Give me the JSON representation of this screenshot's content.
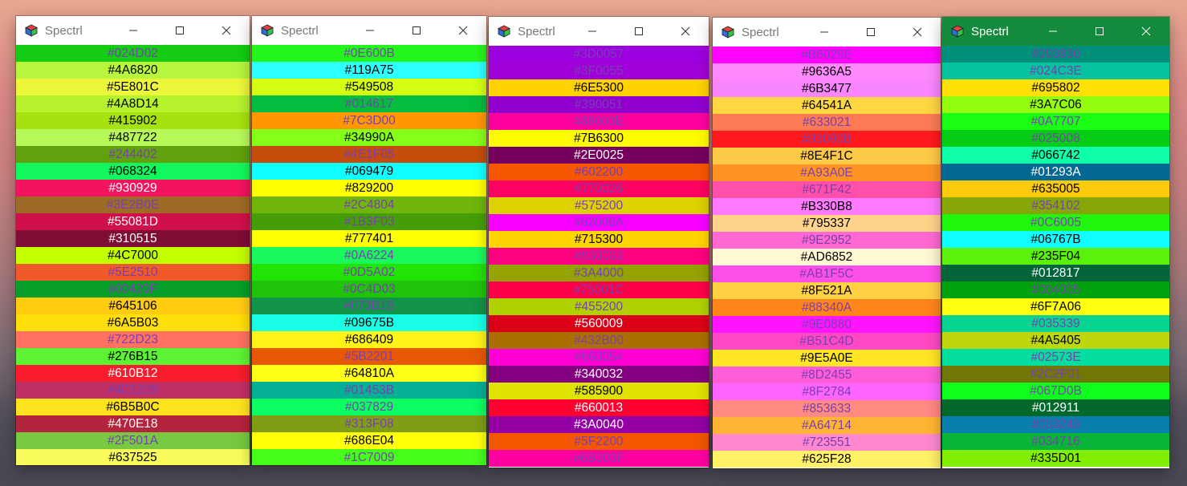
{
  "windows": [
    {
      "title": "Spectrl",
      "active": false,
      "rows": [
        {
          "label": "#024D02",
          "bg": "#13cc13",
          "fg": "#7a3fb0"
        },
        {
          "label": "#4A6820",
          "bg": "#b8f53f",
          "fg": "#000000"
        },
        {
          "label": "#5E801C",
          "bg": "#ecf73a",
          "fg": "#000000"
        },
        {
          "label": "#4A8D14",
          "bg": "#b7f22f",
          "fg": "#000000"
        },
        {
          "label": "#415902",
          "bg": "#a6e20f",
          "fg": "#000000"
        },
        {
          "label": "#487722",
          "bg": "#b8f95a",
          "fg": "#000000"
        },
        {
          "label": "#244402",
          "bg": "#61a10d",
          "fg": "#7a3fb0"
        },
        {
          "label": "#068324",
          "bg": "#12f75d",
          "fg": "#000000"
        },
        {
          "label": "#930929",
          "bg": "#f3135f",
          "fg": "#ffffff"
        },
        {
          "label": "#3E2B0E",
          "bg": "#9d6b25",
          "fg": "#7a3fb0"
        },
        {
          "label": "#55081D",
          "bg": "#d0104a",
          "fg": "#ffffff"
        },
        {
          "label": "#310515",
          "bg": "#7f0d36",
          "fg": "#ffffff"
        },
        {
          "label": "#4C7000",
          "bg": "#c3ff00",
          "fg": "#000000"
        },
        {
          "label": "#5E2510",
          "bg": "#f05a28",
          "fg": "#7a3fb0"
        },
        {
          "label": "#00420F",
          "bg": "#079e29",
          "fg": "#7a3fb0"
        },
        {
          "label": "#645106",
          "bg": "#ffcc10",
          "fg": "#000000"
        },
        {
          "label": "#6A5B03",
          "bg": "#ffdf07",
          "fg": "#000000"
        },
        {
          "label": "#722D23",
          "bg": "#ff7160",
          "fg": "#7a3fb0"
        },
        {
          "label": "#276B15",
          "bg": "#5ef235",
          "fg": "#000000"
        },
        {
          "label": "#610B12",
          "bg": "#f81c2c",
          "fg": "#ffffff"
        },
        {
          "label": "#4C1228",
          "bg": "#c02e66",
          "fg": "#7a3fb0"
        },
        {
          "label": "#6B5B0C",
          "bg": "#ffe21e",
          "fg": "#000000"
        },
        {
          "label": "#470E18",
          "bg": "#b5243d",
          "fg": "#ffffff"
        },
        {
          "label": "#2F501A",
          "bg": "#78c842",
          "fg": "#7a3fb0"
        },
        {
          "label": "#637525",
          "bg": "#f9fb5c",
          "fg": "#000000"
        }
      ]
    },
    {
      "title": "Spectrl",
      "active": false,
      "rows": [
        {
          "label": "#0E600B",
          "bg": "#24f61c",
          "fg": "#7a3fb0"
        },
        {
          "label": "#119A75",
          "bg": "#2effff",
          "fg": "#000000"
        },
        {
          "label": "#549508",
          "bg": "#d4ff13",
          "fg": "#000000"
        },
        {
          "label": "#014617",
          "bg": "#04bd3e",
          "fg": "#7a3fb0"
        },
        {
          "label": "#7C3D00",
          "bg": "#ff9800",
          "fg": "#7a3fb0"
        },
        {
          "label": "#34990A",
          "bg": "#86ff19",
          "fg": "#000000"
        },
        {
          "label": "#4E1F05",
          "bg": "#c44d0c",
          "fg": "#7a3fb0"
        },
        {
          "label": "#069479",
          "bg": "#10ffff",
          "fg": "#000000"
        },
        {
          "label": "#829200",
          "bg": "#ffff00",
          "fg": "#000000"
        },
        {
          "label": "#2C4804",
          "bg": "#70b50a",
          "fg": "#7a3fb0"
        },
        {
          "label": "#1B3F03",
          "bg": "#459e07",
          "fg": "#7a3fb0"
        },
        {
          "label": "#777401",
          "bg": "#ffff03",
          "fg": "#000000"
        },
        {
          "label": "#0A6224",
          "bg": "#19f95c",
          "fg": "#7a3fb0"
        },
        {
          "label": "#0D5A02",
          "bg": "#21e305",
          "fg": "#7a3fb0"
        },
        {
          "label": "#0C4D03",
          "bg": "#1fc408",
          "fg": "#7a3fb0"
        },
        {
          "label": "#073B1B",
          "bg": "#129449",
          "fg": "#7a3fb0"
        },
        {
          "label": "#09675B",
          "bg": "#18ffe6",
          "fg": "#000000"
        },
        {
          "label": "#686409",
          "bg": "#fff416",
          "fg": "#000000"
        },
        {
          "label": "#5B2201",
          "bg": "#e85804",
          "fg": "#7a3fb0"
        },
        {
          "label": "#64810A",
          "bg": "#fffe17",
          "fg": "#000000"
        },
        {
          "label": "#01453B",
          "bg": "#04b093",
          "fg": "#7a3fb0"
        },
        {
          "label": "#037829",
          "bg": "#0cfe62",
          "fg": "#7a3fb0"
        },
        {
          "label": "#313F08",
          "bg": "#7f9e16",
          "fg": "#7a3fb0"
        },
        {
          "label": "#686E04",
          "bg": "#ffff0a",
          "fg": "#000000"
        },
        {
          "label": "#1C7009",
          "bg": "#46fd1c",
          "fg": "#7a3fb0"
        }
      ]
    },
    {
      "title": "Spectrl",
      "active": false,
      "rows": [
        {
          "label": "#3D0057",
          "bg": "#9b00de",
          "fg": "#7a3fb0"
        },
        {
          "label": "#3F0055",
          "bg": "#a000d8",
          "fg": "#7a3fb0"
        },
        {
          "label": "#6E5300",
          "bg": "#ffd200",
          "fg": "#000000"
        },
        {
          "label": "#390051",
          "bg": "#9100cf",
          "fg": "#7a3fb0"
        },
        {
          "label": "#88003E",
          "bg": "#ff009e",
          "fg": "#7a3fb0"
        },
        {
          "label": "#7B6300",
          "bg": "#fffb00",
          "fg": "#000000"
        },
        {
          "label": "#2E0025",
          "bg": "#75005e",
          "fg": "#ffffff"
        },
        {
          "label": "#602200",
          "bg": "#f55600",
          "fg": "#7a3fb0"
        },
        {
          "label": "#770026",
          "bg": "#fe0061",
          "fg": "#7a3fb0"
        },
        {
          "label": "#575200",
          "bg": "#ddd100",
          "fg": "#7a3fb0"
        },
        {
          "label": "#62006A",
          "bg": "#f800ff",
          "fg": "#7a3fb0"
        },
        {
          "label": "#715300",
          "bg": "#ffd400",
          "fg": "#000000"
        },
        {
          "label": "#830033",
          "bg": "#ff0081",
          "fg": "#7a3fb0"
        },
        {
          "label": "#3A4000",
          "bg": "#94a300",
          "fg": "#7a3fb0"
        },
        {
          "label": "#75001C",
          "bg": "#ff0048",
          "fg": "#7a3fb0"
        },
        {
          "label": "#455200",
          "bg": "#b0d100",
          "fg": "#7a3fb0"
        },
        {
          "label": "#560009",
          "bg": "#db0017",
          "fg": "#ffffff"
        },
        {
          "label": "#432B00",
          "bg": "#ab6e00",
          "fg": "#7a3fb0"
        },
        {
          "label": "#660054",
          "bg": "#ff00d4",
          "fg": "#7a3fb0"
        },
        {
          "label": "#340032",
          "bg": "#850080",
          "fg": "#ffffff"
        },
        {
          "label": "#585900",
          "bg": "#e0e200",
          "fg": "#000000"
        },
        {
          "label": "#660013",
          "bg": "#ff0031",
          "fg": "#ffffff"
        },
        {
          "label": "#3A0040",
          "bg": "#9400a3",
          "fg": "#ffffff"
        },
        {
          "label": "#5F2200",
          "bg": "#f25600",
          "fg": "#7a3fb0"
        },
        {
          "label": "#6B003F",
          "bg": "#ff00a0",
          "fg": "#7a3fb0"
        }
      ]
    },
    {
      "title": "Spectrl",
      "active": false,
      "rows": [
        {
          "label": "#B6029E",
          "bg": "#ff05ff",
          "fg": "#7a3fb0"
        },
        {
          "label": "#9636A5",
          "bg": "#ff8aff",
          "fg": "#000000"
        },
        {
          "label": "#6B3477",
          "bg": "#fa86ff",
          "fg": "#000000"
        },
        {
          "label": "#64541A",
          "bg": "#ffd743",
          "fg": "#000000"
        },
        {
          "label": "#633021",
          "bg": "#fc7b55",
          "fg": "#7a3fb0"
        },
        {
          "label": "#93090B",
          "bg": "#ff1a1e",
          "fg": "#7a3fb0"
        },
        {
          "label": "#8E4F1C",
          "bg": "#ffc948",
          "fg": "#000000"
        },
        {
          "label": "#A93A0E",
          "bg": "#ff9425",
          "fg": "#7a3fb0"
        },
        {
          "label": "#671F42",
          "bg": "#ff4fa9",
          "fg": "#7a3fb0"
        },
        {
          "label": "#B330B8",
          "bg": "#ff7aff",
          "fg": "#000000"
        },
        {
          "label": "#795337",
          "bg": "#ffd38c",
          "fg": "#000000"
        },
        {
          "label": "#9E2952",
          "bg": "#ff69d1",
          "fg": "#7a3fb0"
        },
        {
          "label": "#AD6852",
          "bg": "#fff8d2",
          "fg": "#000000"
        },
        {
          "label": "#AB1F5C",
          "bg": "#ff4fea",
          "fg": "#7a3fb0"
        },
        {
          "label": "#8F521A",
          "bg": "#ffd143",
          "fg": "#000000"
        },
        {
          "label": "#88340A",
          "bg": "#ff841a",
          "fg": "#7a3fb0"
        },
        {
          "label": "#9E0880",
          "bg": "#ff15ff",
          "fg": "#7a3fb0"
        },
        {
          "label": "#B51C4D",
          "bg": "#ff48c4",
          "fg": "#7a3fb0"
        },
        {
          "label": "#9E5A0E",
          "bg": "#ffe525",
          "fg": "#000000"
        },
        {
          "label": "#8D2455",
          "bg": "#ff5ed9",
          "fg": "#7a3fb0"
        },
        {
          "label": "#8F2784",
          "bg": "#ff64ff",
          "fg": "#7a3fb0"
        },
        {
          "label": "#853633",
          "bg": "#ff8a82",
          "fg": "#7a3fb0"
        },
        {
          "label": "#A64714",
          "bg": "#ffb533",
          "fg": "#7a3fb0"
        },
        {
          "label": "#723551",
          "bg": "#ff88cf",
          "fg": "#7a3fb0"
        },
        {
          "label": "#625F28",
          "bg": "#fff266",
          "fg": "#000000"
        }
      ]
    },
    {
      "title": "Spectrl",
      "active": true,
      "rows": [
        {
          "label": "#003830",
          "bg": "#008f7a",
          "fg": "#7a3fb0"
        },
        {
          "label": "#024C3E",
          "bg": "#06c29e",
          "fg": "#7a3fb0"
        },
        {
          "label": "#695802",
          "bg": "#ffe005",
          "fg": "#000000"
        },
        {
          "label": "#3A7C06",
          "bg": "#94fd0f",
          "fg": "#000000"
        },
        {
          "label": "#0A7707",
          "bg": "#19fe12",
          "fg": "#7a3fb0"
        },
        {
          "label": "#025008",
          "bg": "#05cc14",
          "fg": "#7a3fb0"
        },
        {
          "label": "#066742",
          "bg": "#0fffa9",
          "fg": "#000000"
        },
        {
          "label": "#01293A",
          "bg": "#036894",
          "fg": "#ffffff"
        },
        {
          "label": "#635005",
          "bg": "#fccb0c",
          "fg": "#000000"
        },
        {
          "label": "#354102",
          "bg": "#87a605",
          "fg": "#7a3fb0"
        },
        {
          "label": "#0C6005",
          "bg": "#1ff50d",
          "fg": "#7a3fb0"
        },
        {
          "label": "#06767B",
          "bg": "#0fffff",
          "fg": "#000000"
        },
        {
          "label": "#235F04",
          "bg": "#5af20a",
          "fg": "#000000"
        },
        {
          "label": "#012817",
          "bg": "#03663b",
          "fg": "#ffffff"
        },
        {
          "label": "#004005",
          "bg": "#00a30d",
          "fg": "#7a3fb0"
        },
        {
          "label": "#6F7A06",
          "bg": "#ffff0f",
          "fg": "#000000"
        },
        {
          "label": "#035339",
          "bg": "#08d492",
          "fg": "#7a3fb0"
        },
        {
          "label": "#4A5405",
          "bg": "#bdd60d",
          "fg": "#000000"
        },
        {
          "label": "#02573E",
          "bg": "#05de9e",
          "fg": "#7a3fb0"
        },
        {
          "label": "#2C2F01",
          "bg": "#707803",
          "fg": "#7a3fb0"
        },
        {
          "label": "#067D0B",
          "bg": "#0fff1c",
          "fg": "#7a3fb0"
        },
        {
          "label": "#012911",
          "bg": "#03682c",
          "fg": "#ffffff"
        },
        {
          "label": "#033243",
          "bg": "#0880ab",
          "fg": "#7a3fb0"
        },
        {
          "label": "#034716",
          "bg": "#08b538",
          "fg": "#7a3fb0"
        },
        {
          "label": "#335D01",
          "bg": "#82ee03",
          "fg": "#000000"
        }
      ]
    }
  ]
}
